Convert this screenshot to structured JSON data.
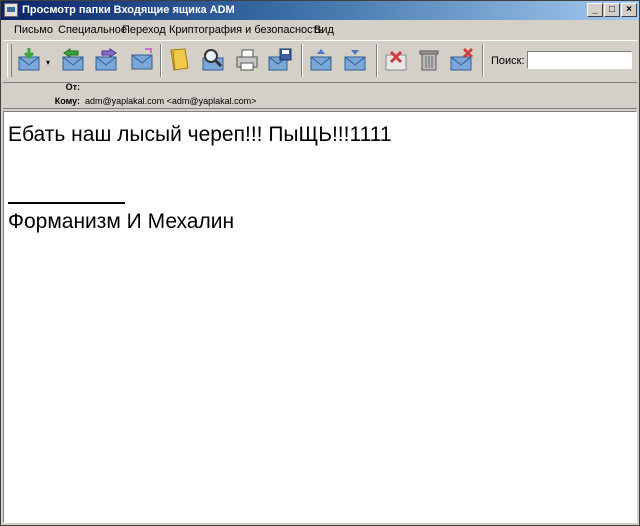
{
  "window": {
    "title": "Просмотр папки Входящие ящика ADM",
    "controls": {
      "minimize": "_",
      "maximize": "□",
      "close": "×"
    }
  },
  "menu": [
    "Письмо",
    "Специальное",
    "Переход",
    "Криптография и безопасность",
    "Вид"
  ],
  "toolbar": {
    "buttons": [
      "get-mail-icon",
      "reply-icon",
      "forward-icon",
      "new-message-icon",
      "address-book-icon",
      "find-icon",
      "print-icon",
      "save-icon",
      "move-up-icon",
      "move-down-icon",
      "mark-icon",
      "delete-icon",
      "junk-icon"
    ],
    "dropdown_glyph": "▾",
    "search_label": "Поиск:",
    "search_value": ""
  },
  "header": {
    "from_label": "От:",
    "from_value": "",
    "to_label": "Кому:",
    "to_value": "adm@yaplakal.com <adm@yaplakal.com>"
  },
  "message": {
    "body": "Ебать наш лысый череп!!! ПыЩЬ!!!1111",
    "signature": "Форманизм И Мехалин"
  },
  "colors": {
    "titlebar": "#0a246a",
    "chrome": "#d4d0c8",
    "envelope": "#7aa7d8",
    "green": "#3aa33a",
    "yellow": "#f2c94c"
  }
}
